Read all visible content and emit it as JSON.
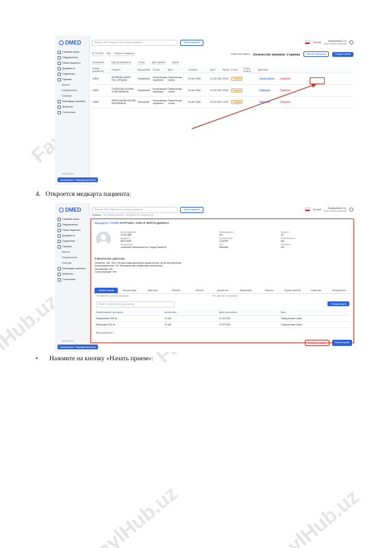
{
  "watermark": "FaylHub.uz",
  "captions": {
    "step4_number": "4.",
    "step4_text": "Откроется медкарта пациента:",
    "bullet": "•",
    "next_step_text": "Нажмите на кнопку «Начать прием»:"
  },
  "app": {
    "logo": "DMED",
    "search_placeholder": "Введите ФИО пациента или номер документа",
    "search_chip": "Поиск пациента",
    "lang": "Русский",
    "user_name": "Ташпулатова С.А.",
    "user_role": "Врач общей практики",
    "version": "v2024.03.01",
    "user_pill": "Ташпулатова Т. Медицинский центр",
    "colors": {
      "accent": "#2d63d8",
      "highlight": "#d23a2a"
    }
  },
  "sidebar": [
    {
      "label": "Главный экран",
      "sub": false,
      "active": false
    },
    {
      "label": "Уведомления",
      "sub": false,
      "active": false
    },
    {
      "label": "Поиск пациента",
      "sub": false,
      "active": false
    },
    {
      "label": "Документы",
      "sub": false,
      "active": false
    },
    {
      "label": "Отделения",
      "sub": false,
      "active": false
    },
    {
      "label": "Приемы",
      "sub": false,
      "active": false
    },
    {
      "label": "Записи",
      "sub": true,
      "active": false
    },
    {
      "label": "Направления",
      "sub": true,
      "active": false
    },
    {
      "label": "Очередь",
      "sub": true,
      "active": false
    },
    {
      "label": "Календарь приемов",
      "sub": false,
      "active": false
    },
    {
      "label": "Шаблоны",
      "sub": false,
      "active": false
    },
    {
      "label": "Статистика",
      "sub": false,
      "active": false
    }
  ],
  "shot1": {
    "filter_date": "01.03.2024",
    "filter_all": "Все",
    "filter_search": "Поиск по пациенту",
    "only_mine": "Только мои записи",
    "count_label": "Количество приемов: 3 приема",
    "btn_filter": "Очистить фильтры",
    "btn_create": "Создать прием",
    "filter_row2": [
      "Специалист",
      "Вид обслуживания",
      "Статус",
      "Дата приема",
      "Время"
    ],
    "headers": [
      "Номер документа",
      "Пациент",
      "Вид приема",
      "Услуга",
      "Врач",
      "Клиника",
      "Дата",
      "Время",
      "Статус",
      "Статус оплаты",
      "Действия",
      ""
    ],
    "rows": [
      {
        "doc": "10834",
        "patient": "ЖУРАЕВА АКМАЛ РАХ. ИРОДОВ",
        "type": "Первичный",
        "service": "Консультация терапевта",
        "doctor": "Ташпулатова Салия",
        "clinic": "В счет ОМС",
        "date": "01.03.2024",
        "time": "09:00",
        "status": "Ожидание",
        "pay": "",
        "act1": "Начать прием",
        "act2": "Отменить"
      },
      {
        "doc": "10921",
        "patient": "ТОЛИПОВА ЛАТИФА ЗУФАЛОВИЧНА",
        "type": "Первичный",
        "service": "Консультация терапевта",
        "doctor": "Ташпулатова Салия",
        "clinic": "В счет ОМС",
        "date": "01.03.2024",
        "time": "09:30",
        "status": "Ожидание",
        "pay": "",
        "act1": "Медкарта",
        "act2": "Отменить"
      },
      {
        "doc": "10953",
        "patient": "ИБРАГИМОВА КАРИМ КАРИМОВНА",
        "type": "Повторный",
        "service": "Консультация терапевта",
        "doctor": "Ташпулатова Салия",
        "clinic": "В счет ОМС",
        "date": "01.03.2024",
        "time": "10:00",
        "status": "Ожидание",
        "pay": "",
        "act1": "Медкарта",
        "act2": "Отменить"
      }
    ]
  },
  "shot2": {
    "crumbs_main": "Приемы",
    "crumbs_rest": "/ ЖУРАЕВА АКМАЛ / МЕДКАРТА ПАЦИЕНТА",
    "title_prefix": "Медкарта",
    "title_id": "16986",
    "title_name": "ЖУРАЕВА АКМАЛ МИРЗАДИЕВНА",
    "info_col1": [
      [
        "Дата рождения",
        "12.08.1985"
      ],
      [
        "Документ",
        "AB1234567"
      ],
      [
        "Прикреплен",
        "Семейная поликлиника №1 города Ташкента"
      ]
    ],
    "info_col2": [
      [
        "Инвалидность",
        "Нет"
      ],
      [
        "Группа крови",
        "II (A) Rh+"
      ],
      [
        "Пол",
        "Женский"
      ]
    ],
    "info_col3": [
      [
        "Возраст",
        "38"
      ],
      [
        "Беременность",
        "Нет"
      ],
      [
        "Аллергия",
        "Нет"
      ]
    ],
    "diag_heading": "Клинические диагнозы",
    "diag_lines": [
      "Основное: J06, J06.9 Острая инфекция верхних дыхательных путей неуточненная",
      "Консультационные: I10 Эссенциальная (первичная) гипертензия",
      "Осложнение: Нет",
      "Сопутствующее: Нет"
    ],
    "tabs": [
      "Анамнез жизни",
      "Консультации",
      "Диагнозы",
      "Анализы",
      "Лечение",
      "Документы",
      "Вакцинация",
      "Рецепты",
      "Журнал записей",
      "Стационар",
      "Направления"
    ],
    "active_tab": 0,
    "note_left": "Нет записей о диспансеризации",
    "note_right": "Нет записей о прививках",
    "rx_search": "Поиск по препарату или дозировке",
    "rx_add": "+ Новый рецепт",
    "rx_headers": [
      "Наименование препарата",
      "Количество",
      "Дата назначения",
      "Врач"
    ],
    "rx_rows": [
      [
        "Парацетамол 500 мг",
        "10 таб",
        "01.03.2024",
        "Ташпулатова Салия"
      ],
      [
        "Ибупрофен 200 мг",
        "20 таб",
        "12.02.2024",
        "Ташпулатова Салия"
      ]
    ],
    "rx_total": "Всего рецептов: 2",
    "btn_cancel": "Отменить прием",
    "btn_start": "Начать прием"
  }
}
